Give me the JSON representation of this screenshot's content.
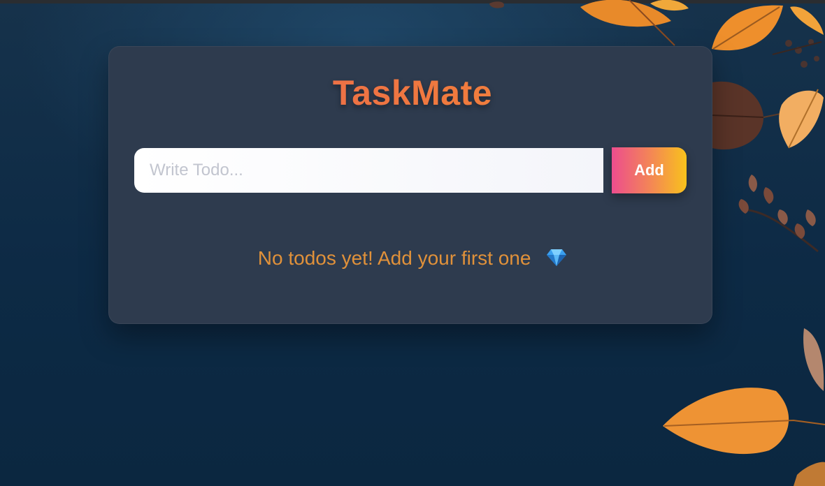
{
  "app": {
    "title": "TaskMate"
  },
  "form": {
    "input_placeholder": "Write Todo...",
    "input_value": "",
    "add_label": "Add"
  },
  "empty_state": {
    "message": "No todos yet! Add your first one",
    "icon": "gem-icon"
  },
  "colors": {
    "background": "#0d2a45",
    "card": "#2e3b4e",
    "title_gradient": [
      "#e85a5a",
      "#f39a3a"
    ],
    "button_gradient": [
      "#ec4d8e",
      "#f8c21c"
    ],
    "empty_text": "#e0913a"
  }
}
